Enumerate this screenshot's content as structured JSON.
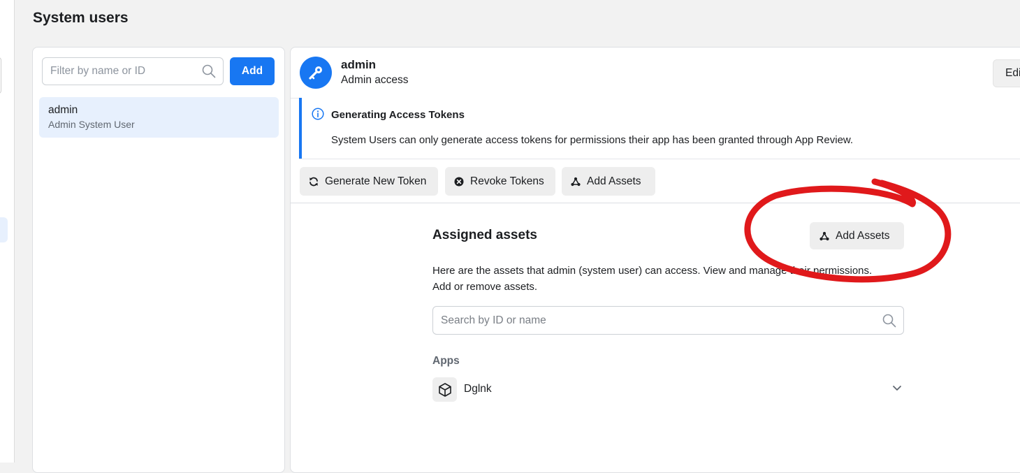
{
  "page": {
    "title": "System users"
  },
  "user_list": {
    "filter_placeholder": "Filter by name or ID",
    "add_label": "Add",
    "items": [
      {
        "name": "admin",
        "role": "Admin System User",
        "selected": true
      }
    ]
  },
  "detail": {
    "user_name": "admin",
    "access_level": "Admin access",
    "edit_label": "Edi",
    "notice": {
      "title": "Generating Access Tokens",
      "body": "System Users can only generate access tokens for permissions their app has been granted through App Review."
    },
    "actions": [
      {
        "label": "Generate New Token",
        "icon": "refresh-icon"
      },
      {
        "label": "Revoke Tokens",
        "icon": "remove-circle-icon"
      },
      {
        "label": "Add Assets",
        "icon": "assets-icon"
      }
    ]
  },
  "assets": {
    "title": "Assigned assets",
    "add_label": "Add Assets",
    "description_line1": "Here are the assets that admin (system user) can access. View and manage their permissions.",
    "description_line2": "Add or remove assets.",
    "search_placeholder": "Search by ID or name",
    "apps_label": "Apps",
    "apps": [
      {
        "name": "Dglnk",
        "icon": "cube-icon"
      }
    ]
  },
  "colors": {
    "accent": "#1877f2",
    "selected_bg": "#e7f0fd",
    "button_bg": "#eeeeee",
    "annotation": "#e0191b"
  }
}
